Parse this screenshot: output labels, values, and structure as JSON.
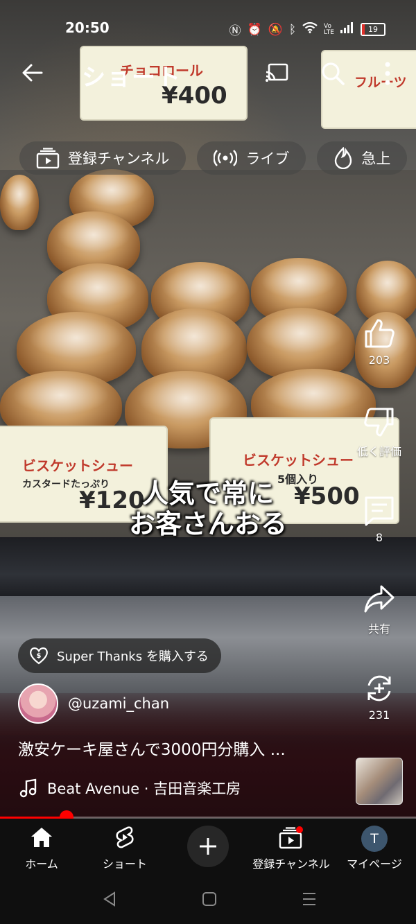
{
  "status": {
    "time": "20:50",
    "battery": "19"
  },
  "header": {
    "title": "ショート"
  },
  "chips": [
    {
      "label": "登録チャンネル",
      "icon": "subscriptions-icon"
    },
    {
      "label": "ライブ",
      "icon": "live-icon"
    },
    {
      "label": "急上",
      "icon": "trending-icon"
    }
  ],
  "video": {
    "price_cards": [
      {
        "name": "チョコロール",
        "price": "¥400"
      },
      {
        "name": "フルーツ",
        "price": ""
      },
      {
        "name": "ビスケットシュー",
        "sub": "カスタードたっぷり",
        "price": "¥120"
      },
      {
        "name": "ビスケットシュー",
        "sub": "5個入り",
        "price": "¥500"
      }
    ],
    "caption_line1": "人気で常に",
    "caption_line2": "お客さんおる"
  },
  "actions": {
    "like_count": "203",
    "dislike_label": "低く評価",
    "comment_count": "8",
    "share_label": "共有",
    "remix_count": "231"
  },
  "super_thanks": "Super Thanks を購入する",
  "channel": {
    "name": "@uzami_chan"
  },
  "video_title": "激安ケーキ屋さんで3000円分購入 ...",
  "music": "Beat Avenue · 吉田音楽工房",
  "progress": 0.16,
  "nav": [
    {
      "label": "ホーム",
      "icon": "home-icon"
    },
    {
      "label": "ショート",
      "icon": "shorts-icon"
    },
    {
      "label": "",
      "icon": "plus-icon"
    },
    {
      "label": "登録チャンネル",
      "icon": "subscriptions-icon"
    },
    {
      "label": "マイページ",
      "icon": "avatar",
      "avatar_letter": "T"
    }
  ],
  "colors": {
    "accent": "#ff0000",
    "nav_bg": "#0f0f0f",
    "avatar_bg": "#3d566e"
  }
}
